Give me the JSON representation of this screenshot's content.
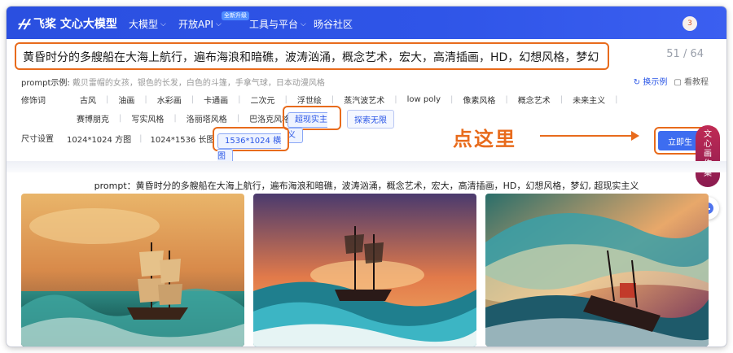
{
  "header": {
    "logo_text": "飞桨 文心大模型",
    "nav": [
      {
        "label": "大模型",
        "has_dropdown": true
      },
      {
        "label": "开放API",
        "has_dropdown": true
      },
      {
        "label": "工具与平台",
        "has_dropdown": true
      },
      {
        "label": "旸谷社区",
        "has_dropdown": false
      }
    ],
    "upgrade_badge": "全新升级",
    "avatar_text": "3"
  },
  "prompt": {
    "value": "黄昏时分的多艘船在大海上航行，遍布海浪和暗礁，波涛汹涌，概念艺术，宏大，高清插画，HD，幻想风格，梦幻",
    "counter": "51 / 64"
  },
  "examples": {
    "label": "prompt示例:",
    "items": "戴贝雷帽的女孩，银色的长发，白色的斗篷，手拿气球，日本动漫风格",
    "refresh_label": "换示例",
    "tutorial_label": "看教程"
  },
  "modifiers": {
    "label": "修饰词",
    "row1": [
      "古风",
      "油画",
      "水彩画",
      "卡通画",
      "二次元",
      "浮世绘",
      "蒸汽波艺术",
      "low poly",
      "像素风格",
      "概念艺术",
      "未来主义"
    ],
    "row2": [
      "赛博朋克",
      "写实风格",
      "洛丽塔风格",
      "巴洛克风格"
    ],
    "selected": "超现实主义",
    "explore": "探索无限"
  },
  "size": {
    "label": "尺寸设置",
    "options": [
      "1024*1024 方图",
      "1024*1536 长图"
    ],
    "selected": "1536*1024 横图"
  },
  "annotation": {
    "click_here": "点这里",
    "color": "#e86b1c"
  },
  "generate_button": "立即生",
  "side_pill": [
    "文",
    "心",
    "画",
    "作",
    "集"
  ],
  "result": {
    "caption": "prompt：黄昏时分的多艘船在大海上航行，遍布海浪和暗礁，波涛汹涌，概念艺术，宏大，高清插画，HD，幻想风格，梦幻, 超现实主义"
  },
  "colors": {
    "brand_blue": "#2f55e8",
    "highlight_orange": "#e86b1c",
    "accent_blue": "#2a56e6"
  }
}
